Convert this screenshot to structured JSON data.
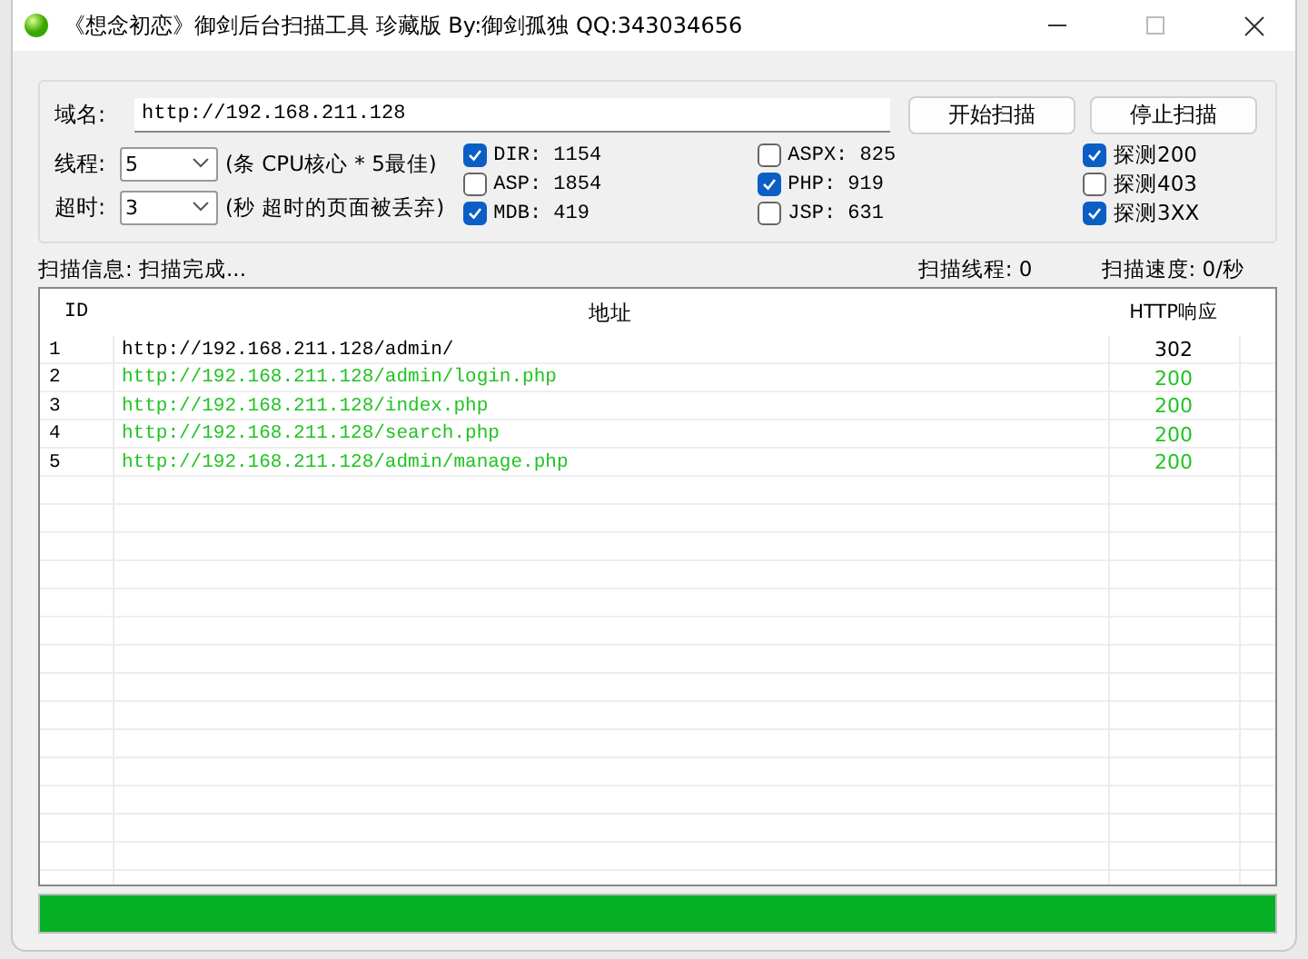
{
  "window": {
    "title": "《想念初恋》御剑后台扫描工具 珍藏版 By:御剑孤独 QQ:343034656"
  },
  "domain": {
    "label": "域名:",
    "value": "http://192.168.211.128"
  },
  "buttons": [
    "开始扫描",
    "停止扫描"
  ],
  "threads": {
    "label": "线程:",
    "value": "5",
    "hint": "(条 CPU核心 * 5最佳)"
  },
  "timeout": {
    "label": "超时:",
    "value": "3",
    "hint": "(秒 超时的页面被丢弃)"
  },
  "dictionaries": [
    {
      "label": "DIR: 1154",
      "checked": true
    },
    {
      "label": "ASP: 1854",
      "checked": false
    },
    {
      "label": "MDB: 419",
      "checked": true
    },
    {
      "label": "ASPX: 825",
      "checked": false
    },
    {
      "label": "PHP: 919",
      "checked": true
    },
    {
      "label": "JSP: 631",
      "checked": false
    }
  ],
  "probes": [
    {
      "label": "探测200",
      "checked": true
    },
    {
      "label": "探测403",
      "checked": false
    },
    {
      "label": "探测3XX",
      "checked": true
    }
  ],
  "status": {
    "info": "扫描信息: 扫描完成...",
    "threads": "扫描线程: 0",
    "speed": "扫描速度: 0/秒"
  },
  "table": {
    "columns": [
      "ID",
      "地址",
      "HTTP响应"
    ],
    "rows": [
      {
        "id": "1",
        "url": "http://192.168.211.128/admin/",
        "code": "302",
        "color": "#000000"
      },
      {
        "id": "2",
        "url": "http://192.168.211.128/admin/login.php",
        "code": "200",
        "color": "#22c322"
      },
      {
        "id": "3",
        "url": "http://192.168.211.128/index.php",
        "code": "200",
        "color": "#22c322"
      },
      {
        "id": "4",
        "url": "http://192.168.211.128/search.php",
        "code": "200",
        "color": "#22c322"
      },
      {
        "id": "5",
        "url": "http://192.168.211.128/admin/manage.php",
        "code": "200",
        "color": "#22c322"
      }
    ]
  },
  "progress": {
    "level": 1
  }
}
